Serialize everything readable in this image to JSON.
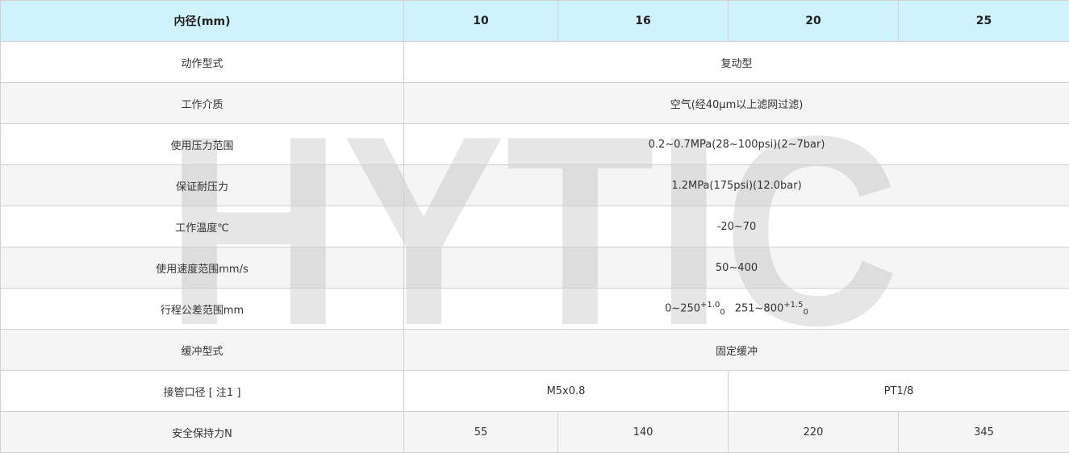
{
  "watermark": {
    "text": "HYTIC"
  },
  "header": {
    "label": "内径(mm)",
    "bores": [
      "10",
      "16",
      "20",
      "25"
    ]
  },
  "rows": {
    "action_type": {
      "label": "动作型式",
      "value": "复动型"
    },
    "medium": {
      "label": "工作介质",
      "value": "空气(经40μm以上滤网过滤)"
    },
    "pressure_range": {
      "label": "使用压力范围",
      "value": "0.2~0.7MPa(28~100psi)(2~7bar)"
    },
    "proof_pressure": {
      "label": "保证耐压力",
      "value": "1.2MPa(175psi)(12.0bar)"
    },
    "temperature": {
      "label": "工作温度℃",
      "value": "-20~70"
    },
    "speed_range": {
      "label": "使用速度范围mm/s",
      "value": "50~400"
    },
    "stroke_tolerance": {
      "label": "行程公差范围mm",
      "range1": "0~250",
      "range1_upper": "+1.0",
      "range1_lower": "0",
      "range2": "251~800",
      "range2_upper": "+1.5",
      "range2_lower": "0"
    },
    "cushion": {
      "label": "缓冲型式",
      "value": "固定缓冲"
    },
    "port_size": {
      "label": "接管口径 [ 注1 ]",
      "value_small": "M5x0.8",
      "value_large": "PT1/8"
    },
    "holding_force": {
      "label": "安全保持力N",
      "values": [
        "55",
        "140",
        "220",
        "345"
      ]
    }
  }
}
